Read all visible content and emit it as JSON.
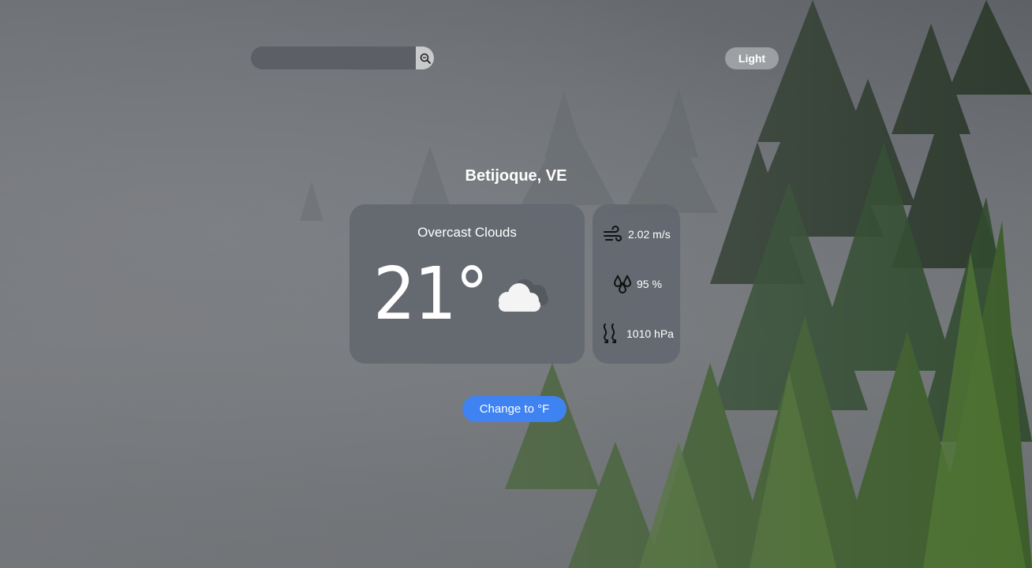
{
  "search": {
    "value": "",
    "placeholder": ""
  },
  "theme_toggle": {
    "label": "Light"
  },
  "location": {
    "city": "Betijoque, VE"
  },
  "weather": {
    "description": "Overcast Clouds",
    "temperature": "21°",
    "icon": "cloud-icon"
  },
  "stats": {
    "wind": "2.02 m/s",
    "humidity": "95 %",
    "pressure": "1010 hPa"
  },
  "unit_button": {
    "label": "Change to °F"
  },
  "colors": {
    "accent": "#3f82f2",
    "card": "#62666f"
  }
}
